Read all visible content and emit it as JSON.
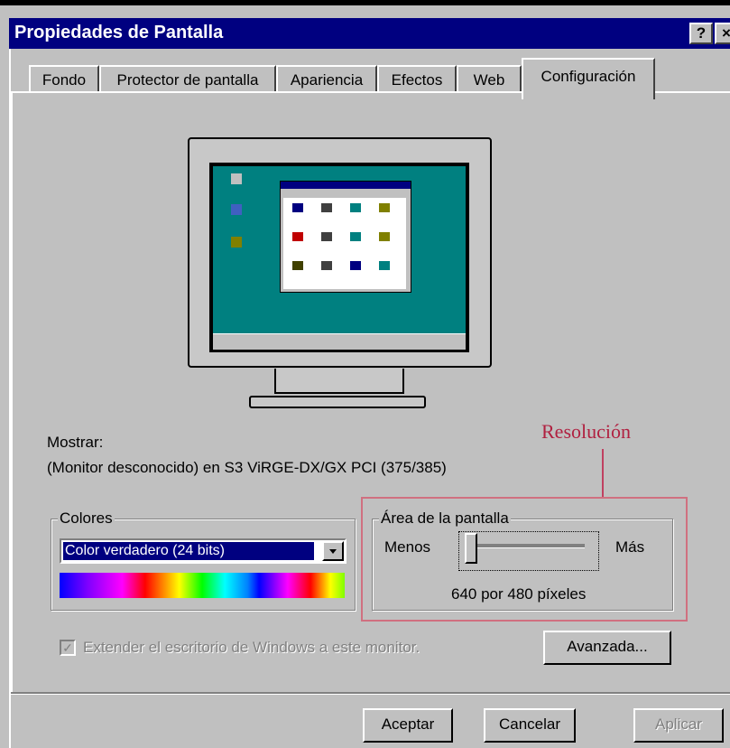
{
  "window": {
    "title": "Propiedades de Pantalla",
    "help_button": "?",
    "close_button": "×"
  },
  "tabs": [
    {
      "label": "Fondo"
    },
    {
      "label": "Protector de pantalla"
    },
    {
      "label": "Apariencia"
    },
    {
      "label": "Efectos"
    },
    {
      "label": "Web"
    },
    {
      "label": "Configuración",
      "active": true
    }
  ],
  "display": {
    "label": "Mostrar:",
    "value": "(Monitor desconocido) en S3 ViRGE-DX/GX PCI (375/385)"
  },
  "colors": {
    "group_label": "Colores",
    "selected": "Color verdadero (24 bits)"
  },
  "screen_area": {
    "group_label": "Área de la pantalla",
    "min_label": "Menos",
    "max_label": "Más",
    "value_text": "640 por 480 píxeles",
    "slider_level": 0
  },
  "extend_checkbox": {
    "label": "Extender el escritorio de Windows a este monitor.",
    "checked": true,
    "disabled": true
  },
  "buttons": {
    "advanced": "Avanzada...",
    "ok": "Aceptar",
    "cancel": "Cancelar",
    "apply": "Aplicar"
  },
  "annotation": {
    "text": "Resolución",
    "color": "#b02040"
  },
  "theme": {
    "titlebar": "#000080",
    "face": "#c0c0c0",
    "desktop": "#008080"
  }
}
